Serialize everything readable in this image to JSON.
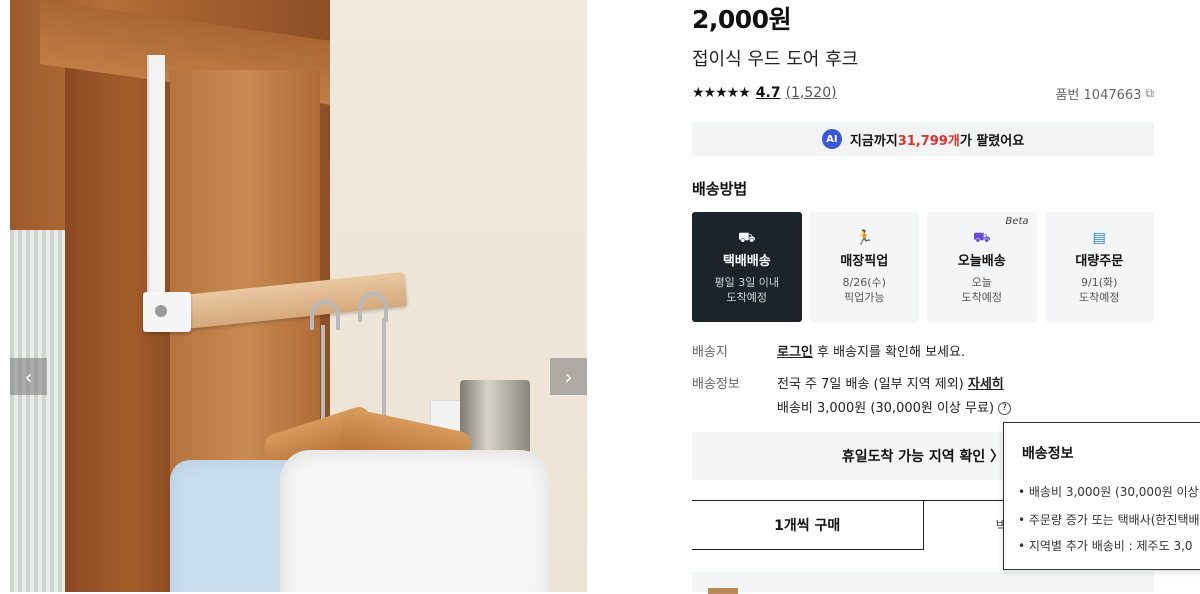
{
  "gallery": {
    "prev_icon": "chevron-left-icon",
    "next_icon": "chevron-right-icon"
  },
  "product": {
    "price": "2,000원",
    "title": "접이식 우드 도어 후크",
    "stars": "★★★★★",
    "rating": "4.7",
    "review_count": "(1,520)",
    "product_number": "품번 1047663",
    "copy_glyph": "⧉"
  },
  "sold_banner": {
    "ai_label": "AI",
    "prefix": "지금까지 ",
    "count": "31,799개",
    "suffix": " 가 팔렸어요"
  },
  "shipping": {
    "heading": "배송방법",
    "options": [
      {
        "icon": "delivery-truck-icon",
        "glyph": "⛟",
        "label": "택배배송",
        "sub1": "평일 3일 이내",
        "sub2": "도착예정",
        "active": true
      },
      {
        "icon": "store-pickup-icon",
        "glyph": "🏃",
        "label": "매장픽업",
        "sub1": "8/26(수)",
        "sub2": "픽업가능",
        "active": false
      },
      {
        "icon": "today-delivery-icon",
        "glyph": "⛟",
        "label": "오늘배송",
        "sub1": "오늘",
        "sub2": "도착예정",
        "active": false,
        "badge": "Beta"
      },
      {
        "icon": "bulk-order-icon",
        "glyph": "▤",
        "label": "대량주문",
        "sub1": "9/1(화)",
        "sub2": "도착예정",
        "active": false
      }
    ]
  },
  "address_row": {
    "label": "배송지",
    "login_link": "로그인",
    "text": " 후 배송지를 확인해 보세요."
  },
  "info_row": {
    "label": "배송정보",
    "line1": "전국 주 7일 배송 (일부 지역 제외) ",
    "detail_link": "자세히",
    "line2": "배송비 3,000원 (30,000원 이상 무료)"
  },
  "holiday_button": "휴일도착 가능 지역 확인 〉",
  "purchase_tabs": {
    "single": "1개씩 구매",
    "box": "박스 단위 구매"
  },
  "popover": {
    "title": "배송정보",
    "items": [
      "• 배송비 3,000원 (30,000원 이상",
      "• 주문량 증가 또는 택배사(한진택배",
      "• 지역별 추가 배송비 : 제주도 3,0"
    ]
  }
}
